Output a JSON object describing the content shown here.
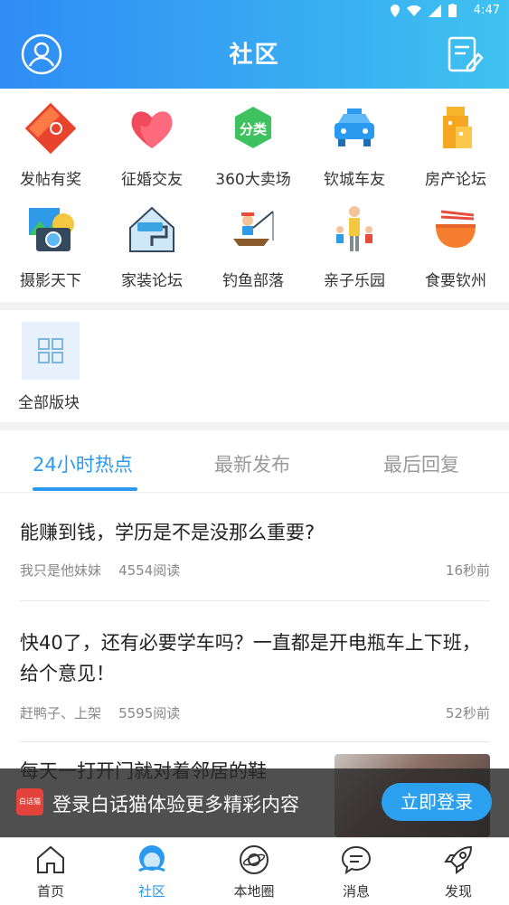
{
  "status_bar": {
    "time": "4:47"
  },
  "header": {
    "title": "社区"
  },
  "categories": [
    {
      "label": "发帖有奖",
      "icon": "red-envelope-icon"
    },
    {
      "label": "征婚交友",
      "icon": "heart-icon"
    },
    {
      "label": "360大卖场",
      "icon": "category-badge-icon",
      "badge": "分类"
    },
    {
      "label": "钦城车友",
      "icon": "taxi-icon"
    },
    {
      "label": "房产论坛",
      "icon": "building-icon"
    },
    {
      "label": "摄影天下",
      "icon": "camera-icon"
    },
    {
      "label": "家装论坛",
      "icon": "paint-roller-house-icon"
    },
    {
      "label": "钓鱼部落",
      "icon": "fishing-icon"
    },
    {
      "label": "亲子乐园",
      "icon": "family-icon"
    },
    {
      "label": "食要钦州",
      "icon": "noodle-bowl-icon"
    }
  ],
  "all_sections": {
    "label": "全部版块"
  },
  "tabs": [
    {
      "label": "24小时热点",
      "active": true
    },
    {
      "label": "最新发布",
      "active": false
    },
    {
      "label": "最后回复",
      "active": false
    }
  ],
  "posts": [
    {
      "title": "能赚到钱，学历是不是没那么重要?",
      "author": "我只是他妹妹",
      "reads": "4554阅读",
      "time": "16秒前"
    },
    {
      "title": "快40了，还有必要学车吗？一直都是开电瓶车上下班，给个意见！",
      "author": "赶鸭子、上架",
      "reads": "5595阅读",
      "time": "52秒前"
    },
    {
      "title": "每天一打开门就对着邻居的鞋",
      "author": "",
      "reads": "",
      "time": ""
    }
  ],
  "banner": {
    "logo_text": "白话猫",
    "text": "登录白话猫体验更多精彩内容",
    "button": "立即登录"
  },
  "bottom_nav": [
    {
      "label": "首页",
      "icon": "home-icon",
      "active": false
    },
    {
      "label": "社区",
      "icon": "community-mascot-icon",
      "active": true
    },
    {
      "label": "本地圈",
      "icon": "planet-icon",
      "active": false
    },
    {
      "label": "消息",
      "icon": "chat-bubble-icon",
      "active": false
    },
    {
      "label": "发现",
      "icon": "rocket-icon",
      "active": false
    }
  ],
  "colors": {
    "accent": "#2a9af0",
    "header_start": "#2f8cf5",
    "header_end": "#3fc2f0"
  }
}
